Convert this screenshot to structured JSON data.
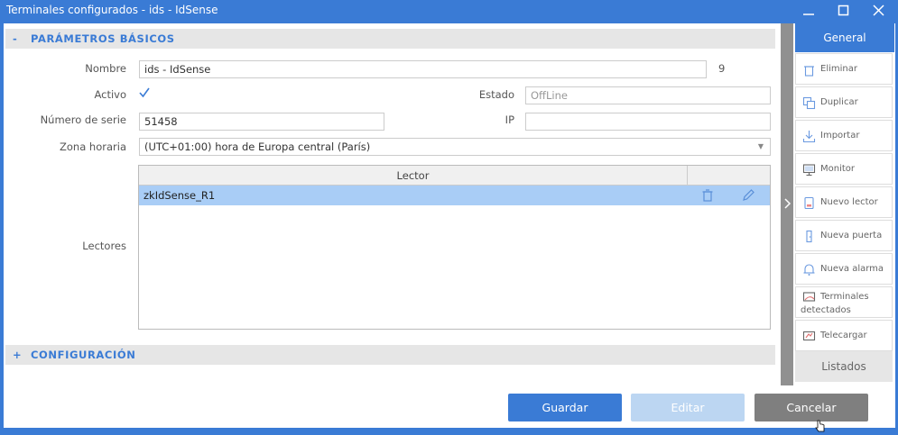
{
  "window": {
    "title": "Terminales configurados - ids - IdSense"
  },
  "sections": {
    "basic": {
      "toggle": "-",
      "title": "PARÁMETROS BÁSICOS"
    },
    "config": {
      "toggle": "+",
      "title": "CONFIGURACIÓN"
    }
  },
  "form": {
    "nombre_label": "Nombre",
    "nombre_value": "ids - IdSense",
    "nombre_count": "9",
    "activo_label": "Activo",
    "activo_checked": true,
    "estado_label": "Estado",
    "estado_value": "OffLine",
    "serie_label": "Número de serie",
    "serie_value": "51458",
    "ip_label": "IP",
    "ip_value": "",
    "zona_label": "Zona horaria",
    "zona_value": "(UTC+01:00) hora de Europa central (París)",
    "lectores_label": "Lectores"
  },
  "readers_table": {
    "column_header": "Lector",
    "rows": [
      {
        "name": "zkIdSense_R1"
      }
    ]
  },
  "sidebar": {
    "general": "General",
    "items": [
      {
        "label": "Eliminar",
        "icon": "trash-icon"
      },
      {
        "label": "Duplicar",
        "icon": "duplicate-icon"
      },
      {
        "label": "Importar",
        "icon": "download-icon"
      },
      {
        "label": "Monitor",
        "icon": "monitor-icon"
      },
      {
        "label": "Nuevo lector",
        "icon": "reader-icon"
      },
      {
        "label": "Nueva puerta",
        "icon": "door-icon"
      },
      {
        "label": "Nueva alarma",
        "icon": "bell-icon"
      },
      {
        "label": "Terminales detectados",
        "icon": "detected-terminals-icon"
      },
      {
        "label": "Telecargar",
        "icon": "telecharge-icon"
      }
    ],
    "listados": "Listados"
  },
  "buttons": {
    "save": "Guardar",
    "edit": "Editar",
    "cancel": "Cancelar"
  },
  "colors": {
    "accent": "#3a7bd5",
    "selected_row": "#a9cdf6",
    "cancel": "#7f7f7f"
  }
}
